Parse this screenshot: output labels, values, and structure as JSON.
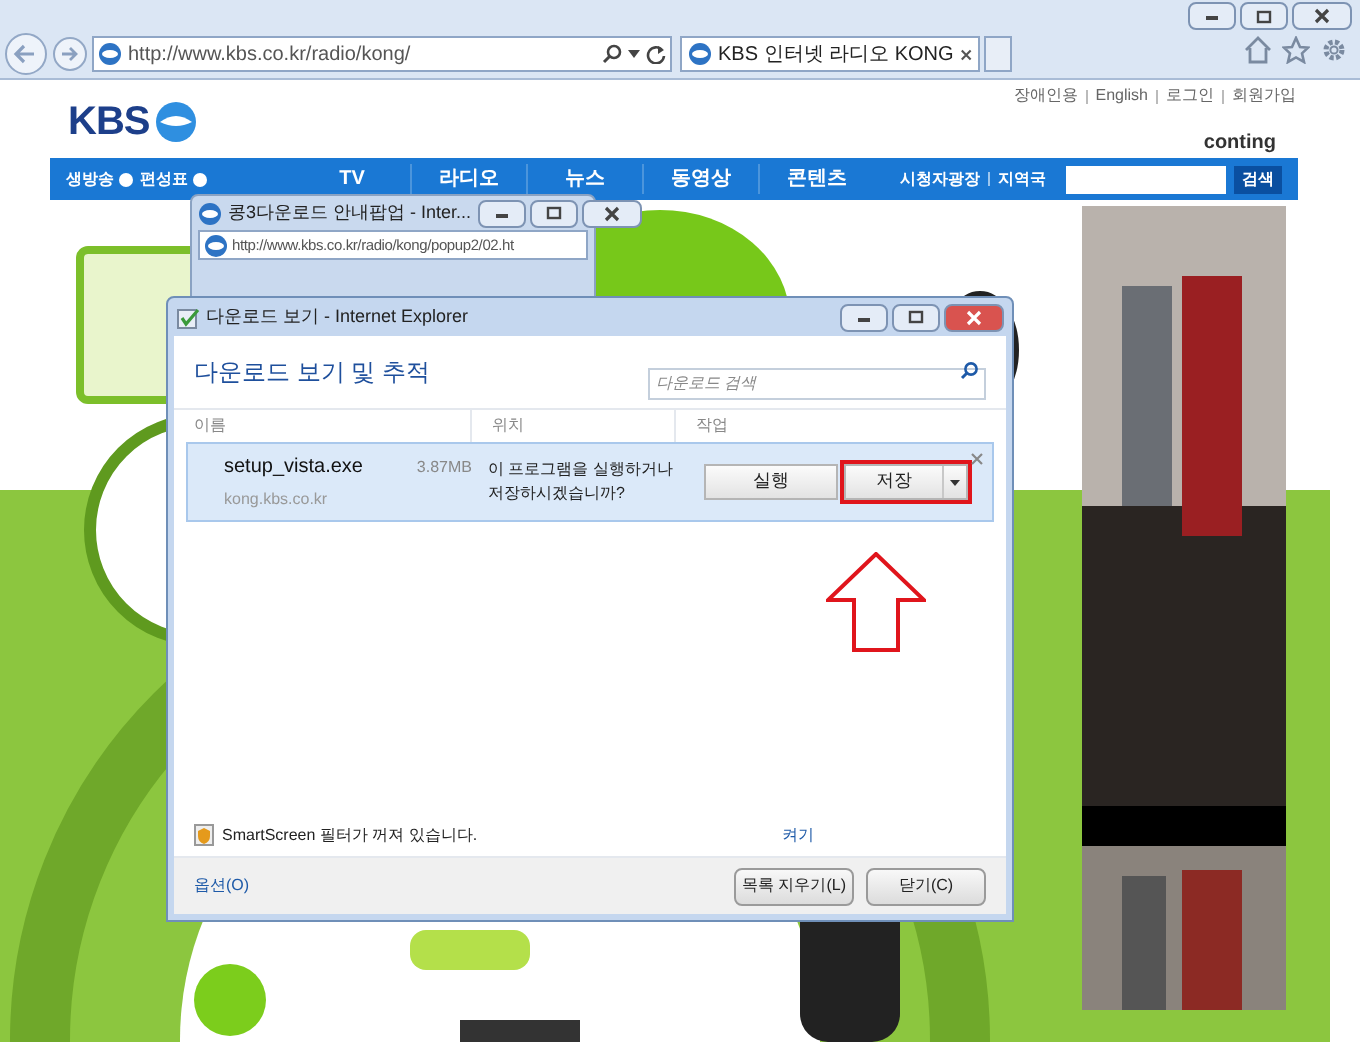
{
  "browser": {
    "address": "http://www.kbs.co.kr/radio/kong/",
    "tabs": [
      {
        "title": "KBS 인터넷 라디오 KONG",
        "selected": true
      }
    ]
  },
  "page": {
    "top_links": [
      "장애인용",
      "English",
      "로그인",
      "회원가입"
    ],
    "logo": "KBS",
    "brand": "conting",
    "nav_left": [
      "생방송",
      "편성표"
    ],
    "nav": [
      "TV",
      "라디오",
      "뉴스",
      "동영상",
      "콘텐츠"
    ],
    "nav_right": [
      "시청자광장",
      "지역국"
    ],
    "search_button": "검색"
  },
  "popup": {
    "title": "콩3다운로드 안내팝업 - Inter...",
    "address": "http://www.kbs.co.kr/radio/kong/popup2/02.ht"
  },
  "dialog": {
    "title": "다운로드 보기 - Internet Explorer",
    "heading": "다운로드 보기 및 추적",
    "search": {
      "placeholder": "다운로드 검색"
    },
    "columns": [
      "이름",
      "위치",
      "작업"
    ],
    "downloads": [
      {
        "file": "setup_vista.exe",
        "size": "3.87MB",
        "source": "kong.kbs.co.kr",
        "message": "이 프로그램을 실행하거나 저장하시겠습니까?",
        "actions": [
          {
            "label": "실행",
            "highlighted": false
          },
          {
            "label": "저장",
            "highlighted": true
          }
        ],
        "selected": true
      }
    ],
    "smartscreen": {
      "text": "SmartScreen 필터가 꺼져 있습니다.",
      "link": "켜기"
    },
    "options_link": "옵션(O)",
    "buttons": [
      "목록 지우기(L)",
      "닫기(C)"
    ]
  }
}
